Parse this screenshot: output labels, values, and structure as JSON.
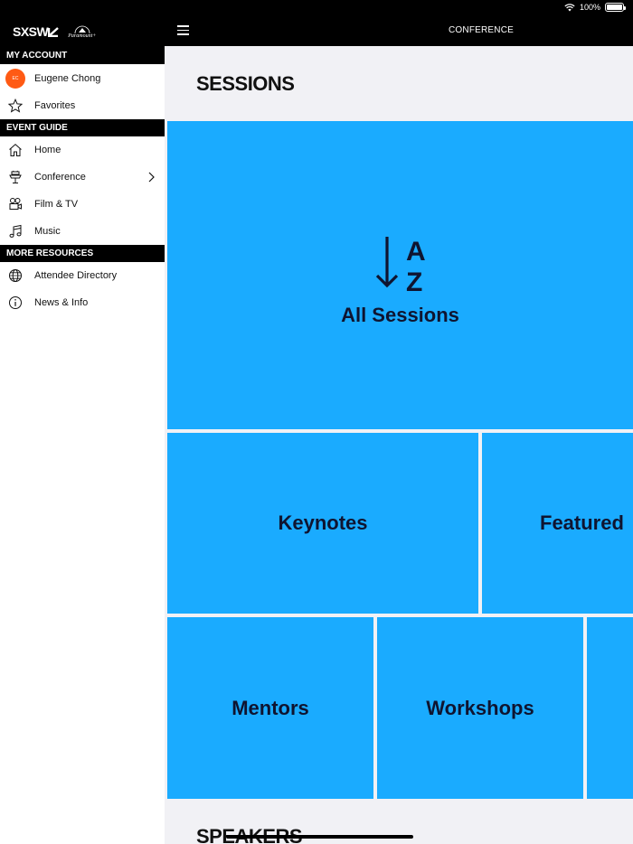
{
  "status": {
    "battery_text": "100%",
    "battery_level": 1.0
  },
  "brand": {
    "logo": "SXSW",
    "partner": "Paramount+"
  },
  "sidebar": {
    "sections": [
      {
        "header": "MY ACCOUNT"
      },
      {
        "header": "EVENT GUIDE"
      },
      {
        "header": "MORE RESOURCES"
      }
    ],
    "account": {
      "avatar_initials": "EC",
      "name": "Eugene Chong",
      "favorites": "Favorites"
    },
    "guide": {
      "home": "Home",
      "conference": "Conference",
      "film_tv": "Film & TV",
      "music": "Music"
    },
    "resources": {
      "directory": "Attendee Directory",
      "news": "News & Info"
    }
  },
  "topbar": {
    "title": "CONFERENCE"
  },
  "main": {
    "title": "SESSIONS",
    "tiles": {
      "all_sessions": "All Sessions",
      "az_top": "A",
      "az_bottom": "Z",
      "keynotes": "Keynotes",
      "featured": "Featured",
      "mentors": "Mentors",
      "workshops": "Workshops"
    },
    "next_section": "SPEAKERS"
  },
  "colors": {
    "accent": "#1aabff",
    "avatar": "#ff5a14",
    "header": "#000000"
  }
}
